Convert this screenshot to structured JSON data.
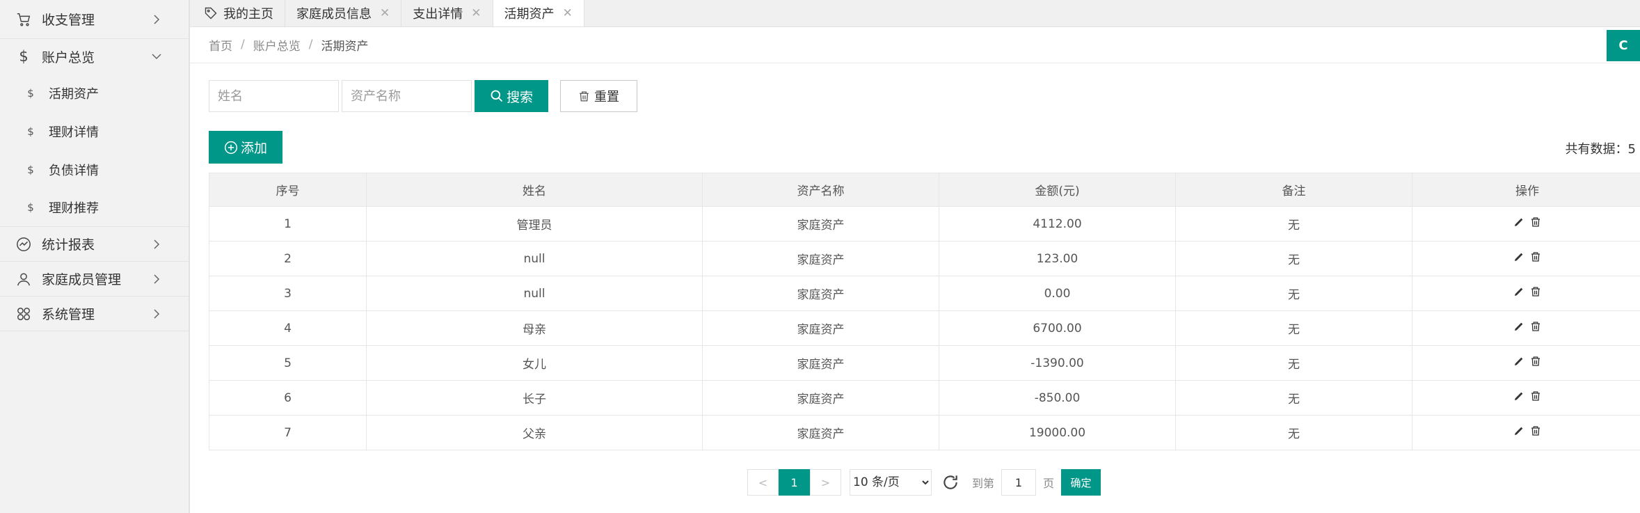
{
  "sidebar": {
    "items": [
      {
        "label": "收支管理",
        "icon": "cart-icon"
      },
      {
        "label": "账户总览",
        "icon": "dollar-icon",
        "expanded": true
      },
      {
        "label": "统计报表",
        "icon": "chart-line-icon"
      },
      {
        "label": "家庭成员管理",
        "icon": "user-icon"
      },
      {
        "label": "系统管理",
        "icon": "grid-icon"
      }
    ],
    "sub_items": [
      {
        "label": "活期资产",
        "icon": "$"
      },
      {
        "label": "理财详情",
        "icon": "$"
      },
      {
        "label": "负债详情",
        "icon": "$"
      },
      {
        "label": "理财推荐",
        "icon": "$"
      }
    ]
  },
  "tabs": [
    {
      "label": "我的主页"
    },
    {
      "label": "家庭成员信息"
    },
    {
      "label": "支出详情"
    },
    {
      "label": "活期资产",
      "active": true
    }
  ],
  "tab_close": "✕",
  "breadcrumb": {
    "home": "首页",
    "sep": "/",
    "parent": "账户总览",
    "current": "活期资产"
  },
  "refresh_label": "C",
  "search": {
    "name_placeholder": "姓名",
    "asset_placeholder": "资产名称",
    "search_label": "搜索",
    "reset_label": "重置"
  },
  "add_label": "添加",
  "total_label": "共有数据：5",
  "table": {
    "headers": [
      "序号",
      "姓名",
      "资产名称",
      "金额(元)",
      "备注",
      "操作"
    ],
    "rows": [
      [
        "1",
        "管理员",
        "家庭资产",
        "4112.00",
        "无"
      ],
      [
        "2",
        "null",
        "家庭资产",
        "123.00",
        "无"
      ],
      [
        "3",
        "null",
        "家庭资产",
        "0.00",
        "无"
      ],
      [
        "4",
        "母亲",
        "家庭资产",
        "6700.00",
        "无"
      ],
      [
        "5",
        "女儿",
        "家庭资产",
        "-1390.00",
        "无"
      ],
      [
        "6",
        "长子",
        "家庭资产",
        "-850.00",
        "无"
      ],
      [
        "7",
        "父亲",
        "家庭资产",
        "19000.00",
        "无"
      ]
    ]
  },
  "pager": {
    "prev": "<",
    "current": "1",
    "next": ">",
    "page_size": "10 条/页",
    "goto_label": "到第",
    "goto_value": "1",
    "page_unit": "页",
    "confirm": "确定"
  },
  "colors": {
    "accent": "#009688"
  }
}
